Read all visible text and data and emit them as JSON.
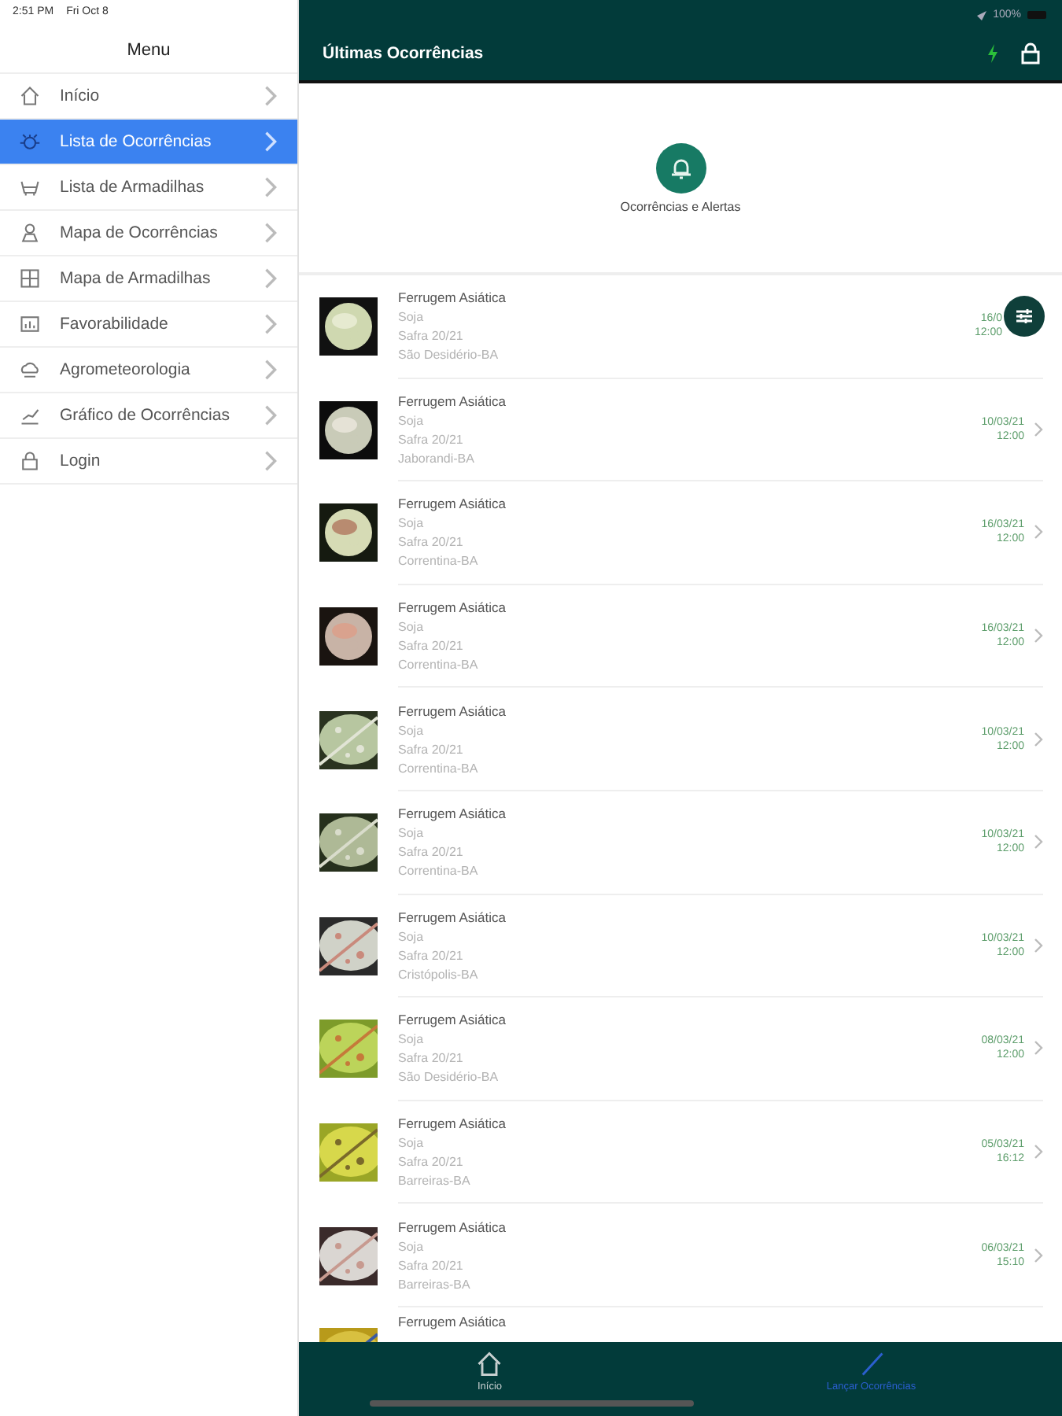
{
  "status_bar": {
    "time": "2:51 PM",
    "date": "Fri Oct 8",
    "battery": "100%"
  },
  "sidebar": {
    "title": "Menu",
    "items": [
      {
        "label": "Início",
        "selected": false
      },
      {
        "label": "Lista de Ocorrências",
        "selected": true
      },
      {
        "label": "Lista de Armadilhas",
        "selected": false
      },
      {
        "label": "Mapa de Ocorrências",
        "selected": false
      },
      {
        "label": "Mapa de Armadilhas",
        "selected": false
      },
      {
        "label": "Favorabilidade",
        "selected": false
      },
      {
        "label": "Agrometeorologia",
        "selected": false
      },
      {
        "label": "Gráfico de Ocorrências",
        "selected": false
      },
      {
        "label": "Login",
        "selected": false
      }
    ]
  },
  "header": {
    "title": "Últimas Ocorrências"
  },
  "alerts": {
    "label": "Ocorrências e Alertas"
  },
  "occurrences": [
    {
      "name": "Ferrugem Asiática",
      "crop": "Soja",
      "season": "Safra 20/21",
      "place": "São Desidério-BA",
      "date": "16/0",
      "time": "12:00",
      "chevron": false
    },
    {
      "name": "Ferrugem Asiática",
      "crop": "Soja",
      "season": "Safra 20/21",
      "place": "Jaborandi-BA",
      "date": "10/03/21",
      "time": "12:00",
      "chevron": true
    },
    {
      "name": "Ferrugem Asiática",
      "crop": "Soja",
      "season": "Safra 20/21",
      "place": "Correntina-BA",
      "date": "16/03/21",
      "time": "12:00",
      "chevron": true
    },
    {
      "name": "Ferrugem Asiática",
      "crop": "Soja",
      "season": "Safra 20/21",
      "place": "Correntina-BA",
      "date": "16/03/21",
      "time": "12:00",
      "chevron": true
    },
    {
      "name": "Ferrugem Asiática",
      "crop": "Soja",
      "season": "Safra 20/21",
      "place": "Correntina-BA",
      "date": "10/03/21",
      "time": "12:00",
      "chevron": true
    },
    {
      "name": "Ferrugem Asiática",
      "crop": "Soja",
      "season": "Safra 20/21",
      "place": "Correntina-BA",
      "date": "10/03/21",
      "time": "12:00",
      "chevron": true
    },
    {
      "name": "Ferrugem Asiática",
      "crop": "Soja",
      "season": "Safra 20/21",
      "place": "Cristópolis-BA",
      "date": "10/03/21",
      "time": "12:00",
      "chevron": true
    },
    {
      "name": "Ferrugem Asiática",
      "crop": "Soja",
      "season": "Safra 20/21",
      "place": "São Desidério-BA",
      "date": "08/03/21",
      "time": "12:00",
      "chevron": true
    },
    {
      "name": "Ferrugem Asiática",
      "crop": "Soja",
      "season": "Safra 20/21",
      "place": "Barreiras-BA",
      "date": "05/03/21",
      "time": "16:12",
      "chevron": true
    },
    {
      "name": "Ferrugem Asiática",
      "crop": "Soja",
      "season": "Safra 20/21",
      "place": "Barreiras-BA",
      "date": "06/03/21",
      "time": "15:10",
      "chevron": true
    },
    {
      "name": "Ferrugem Asiática"
    }
  ],
  "tab_bar": [
    {
      "label": "Início",
      "selected": false
    },
    {
      "label": "Lançar Ocorrências",
      "selected": true
    }
  ]
}
